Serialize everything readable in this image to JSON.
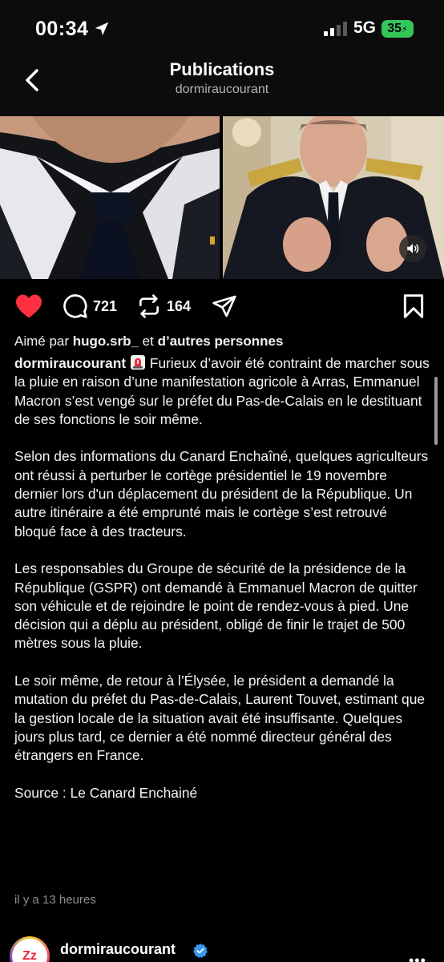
{
  "status_bar": {
    "time": "00:34",
    "network": "5G",
    "battery": "35"
  },
  "header": {
    "title": "Publications",
    "subtitle": "dormiraucourant"
  },
  "actions": {
    "comments": "721",
    "reposts": "164"
  },
  "likes": {
    "prefix": "Aimé par",
    "user": "hugo.srb_",
    "middle": "et",
    "others": "d’autres personnes"
  },
  "caption": {
    "author": "dormiraucourant",
    "paragraph1": "Furieux d’avoir été contraint de marcher sous la pluie en raison d’une manifestation agricole à Arras, Emmanuel Macron s’est vengé sur le préfet du Pas-de-Calais en le destituant de ses fonctions le soir même.",
    "paragraph2": "Selon des informations du Canard Enchaîné, quelques agriculteurs ont réussi à perturber le cortège présidentiel le 19 novembre dernier lors d'un déplacement du président de la République. Un autre itinéraire a été emprunté mais le cortège s’est retrouvé bloqué face à des tracteurs.",
    "paragraph3": "Les responsables du Groupe de sécurité de la présidence de la République (GSPR) ont demandé à Emmanuel Macron de quitter son véhicule et de rejoindre le point de rendez-vous à pied. Une décision qui a déplu au président, obligé de finir le trajet de 500 mètres sous la pluie.",
    "paragraph4": "Le soir même, de retour à l’Élysée, le président a demandé la mutation du préfet du Pas-de-Calais, Laurent Touvet, estimant que la gestion locale de la situation avait été insuffisante. Quelques jours plus tard, ce dernier a été nommé directeur général des étrangers en France.",
    "source": "Source : Le Canard Enchainé"
  },
  "timestamp": "il y a 13 heures",
  "next_post": {
    "author": "dormiraucourant",
    "avatar_text": "Zz"
  },
  "colors": {
    "like": "#ff3040",
    "background": "#000000",
    "verified": "#3897f0"
  },
  "icons": [
    "location-arrow-icon",
    "signal-icon",
    "back-chevron-icon",
    "heart-icon",
    "comment-icon",
    "repost-icon",
    "share-icon",
    "bookmark-icon",
    "sound-icon",
    "siren-emoji-icon",
    "verified-icon",
    "more-icon"
  ]
}
